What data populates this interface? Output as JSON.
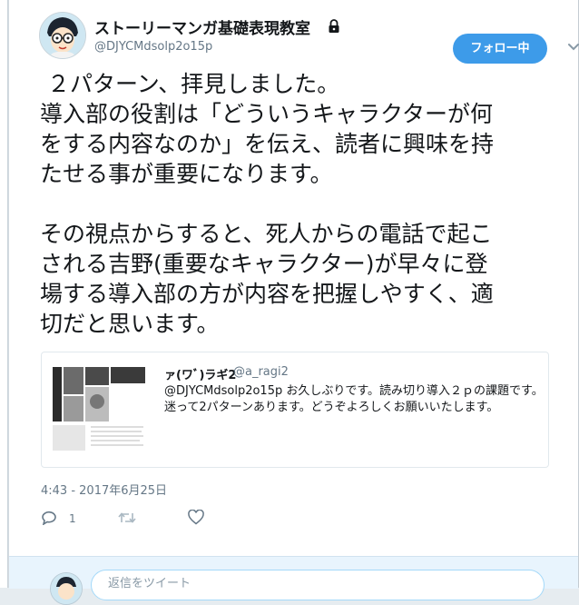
{
  "header": {
    "display_name": "ストーリーマンガ基礎表現教室",
    "handle": "@DJYCMdsolp2o15p",
    "follow_label": "フォロー中"
  },
  "tweet": {
    "text": " ２パターン、拝見しました。\n導入部の役割は「どういうキャラクターが何\nをする内容なのか」を伝え、読者に興味を持\nたせる事が重要になります。\n\nその視点からすると、死人からの電話で起こ\nされる吉野(重要なキャラクター)が早々に登\n場する導入部の方が内容を把握しやすく、適\n切だと思います。"
  },
  "quoted_tweet": {
    "name": "ァ(ワﾞ)ラギ2",
    "handle": "@a_ragi2",
    "text": "@DJYCMdsolp2o15p お久しぶりです。読み切り導入２ｐの課題です。迷って2パターンあります。どうぞよろしくお願いいたします。"
  },
  "meta": {
    "timestamp": "4:43 - 2017年6月25日"
  },
  "actions": {
    "reply_count": "1"
  },
  "reply_box": {
    "placeholder": "返信をツイート"
  },
  "colors": {
    "accent": "#3d9be9",
    "text": "#14171a",
    "muted": "#657786"
  }
}
